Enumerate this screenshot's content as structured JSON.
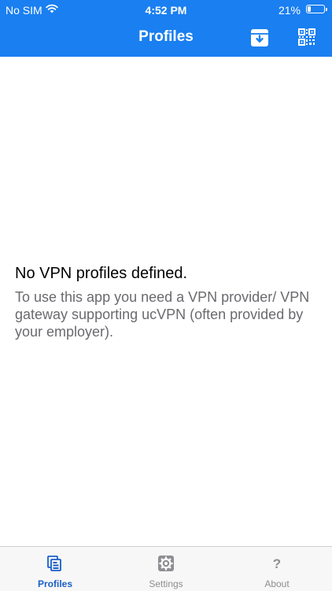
{
  "status_bar": {
    "carrier": "No SIM",
    "time": "4:52 PM",
    "battery_percent": "21%",
    "battery_level": 0.21
  },
  "nav": {
    "title": "Profiles",
    "actions": [
      {
        "icon": "import-icon"
      },
      {
        "icon": "qr-code-icon"
      }
    ]
  },
  "empty_state": {
    "title": "No VPN profiles defined.",
    "description": "To use this app you need a VPN provider/ VPN gateway supporting ucVPN (often provided by your employer)."
  },
  "tabs": [
    {
      "label": "Profiles",
      "icon": "profiles-icon",
      "active": true
    },
    {
      "label": "Settings",
      "icon": "gear-icon",
      "active": false
    },
    {
      "label": "About",
      "icon": "question-icon",
      "active": false
    }
  ],
  "colors": {
    "accent": "#1a7ff0",
    "tab_active": "#1a5fc8",
    "tab_inactive": "#8e8e93"
  }
}
